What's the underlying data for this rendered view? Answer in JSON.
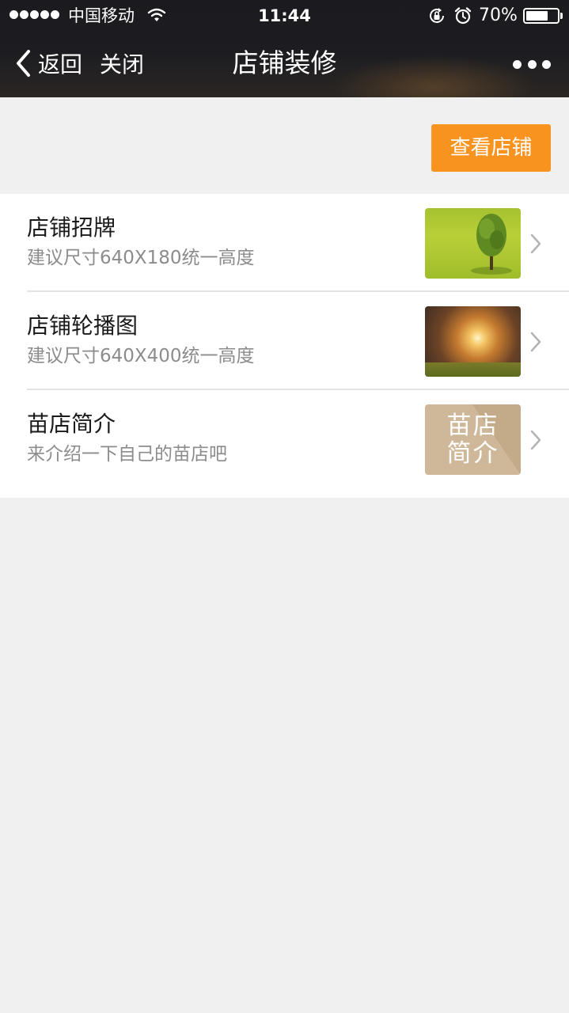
{
  "status_bar": {
    "carrier": "中国移动",
    "time": "11:44",
    "battery": "70%",
    "battery_level": 0.7
  },
  "nav": {
    "back_label": "返回",
    "close_label": "关闭",
    "title": "店铺装修"
  },
  "toolbar": {
    "view_shop_label": "查看店铺",
    "accent_color": "#f7931e"
  },
  "items": [
    {
      "title": "店铺招牌",
      "description": "建议尺寸640X180统一高度",
      "thumbnail": "tree-on-grass"
    },
    {
      "title": "店铺轮播图",
      "description": "建议尺寸640X400统一高度",
      "thumbnail": "sunset-forest"
    },
    {
      "title": "苗店简介",
      "description": "来介绍一下自己的苗店吧",
      "thumbnail": "text-tile",
      "thumbnail_text": [
        "苗店",
        "简介"
      ]
    }
  ]
}
